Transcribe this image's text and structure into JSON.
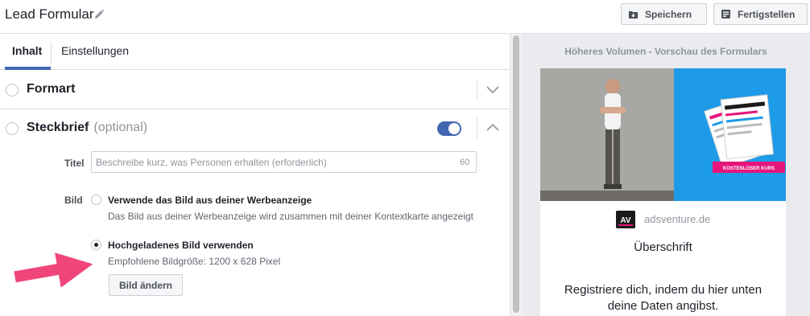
{
  "header": {
    "title": "Lead Formular",
    "save_label": "Speichern",
    "finish_label": "Fertigstellen"
  },
  "tabs": [
    {
      "label": "Inhalt",
      "active": true
    },
    {
      "label": "Einstellungen",
      "active": false
    }
  ],
  "sections": {
    "format": {
      "title": "Formart",
      "expanded": false
    },
    "profile": {
      "title": "Steckbrief",
      "optional": "(optional)",
      "enabled": true,
      "expanded": true,
      "title_field": {
        "label": "Titel",
        "placeholder": "Beschreibe kurz, was Personen erhalten (erforderlich)",
        "value": "",
        "char_limit": "60"
      },
      "image": {
        "label": "Bild",
        "options": [
          {
            "title": "Verwende das Bild aus deiner Werbeanzeige",
            "description": "Das Bild aus deiner Werbeanzeige wird zusammen mit deiner Kontextkarte angezeigt",
            "selected": false
          },
          {
            "title": "Hochgeladenes Bild verwenden",
            "description": "Empfohlene Bildgröße: 1200 x 628 Pixel",
            "selected": true
          }
        ],
        "change_button": "Bild ändern"
      }
    }
  },
  "preview": {
    "title": "Höheres Volumen - Vorschau des Formulars",
    "brand_name": "adsventure.de",
    "brand_logo_text": "AV",
    "banner_text": "KOSTENLOSER KURS",
    "headline": "Überschrift",
    "description_line1": "Registriere dich, indem du hier unten",
    "description_line2": "deine Daten angibst."
  },
  "colors": {
    "accent": "#4267b2",
    "hero_blue": "#1e9be8",
    "arrow_pink": "#f0457a",
    "banner_pink": "#e5157a"
  },
  "icons": [
    "pencil-icon",
    "save-icon",
    "finish-icon",
    "chevron-down-icon",
    "chevron-up-icon"
  ]
}
